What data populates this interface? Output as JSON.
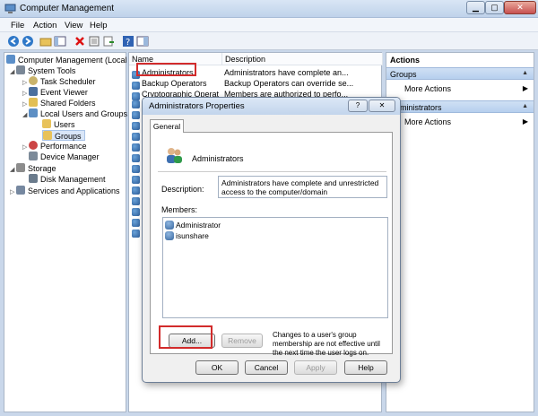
{
  "window": {
    "title": "Computer Management"
  },
  "menu": [
    "File",
    "Action",
    "View",
    "Help"
  ],
  "tree": [
    {
      "label": "Computer Management (Local",
      "indent": 0,
      "arrow": ""
    },
    {
      "label": "System Tools",
      "indent": 1,
      "arrow": "◢"
    },
    {
      "label": "Task Scheduler",
      "indent": 2,
      "arrow": "▷"
    },
    {
      "label": "Event Viewer",
      "indent": 2,
      "arrow": "▷"
    },
    {
      "label": "Shared Folders",
      "indent": 2,
      "arrow": "▷"
    },
    {
      "label": "Local Users and Groups",
      "indent": 2,
      "arrow": "◢"
    },
    {
      "label": "Users",
      "indent": 3,
      "arrow": ""
    },
    {
      "label": "Groups",
      "indent": 3,
      "arrow": ""
    },
    {
      "label": "Performance",
      "indent": 2,
      "arrow": "▷"
    },
    {
      "label": "Device Manager",
      "indent": 2,
      "arrow": ""
    },
    {
      "label": "Storage",
      "indent": 1,
      "arrow": "◢"
    },
    {
      "label": "Disk Management",
      "indent": 2,
      "arrow": ""
    },
    {
      "label": "Services and Applications",
      "indent": 1,
      "arrow": "▷"
    }
  ],
  "list": {
    "columns": [
      "Name",
      "Description"
    ],
    "rows": [
      {
        "name": "Administrators",
        "desc": "Administrators have complete an..."
      },
      {
        "name": "Backup Operators",
        "desc": "Backup Operators can override se..."
      },
      {
        "name": "Cryptographic Operat",
        "desc": "Members are authorized to perfo..."
      },
      {
        "name": "",
        "desc": ""
      },
      {
        "name": "",
        "desc": ""
      },
      {
        "name": "",
        "desc": ""
      },
      {
        "name": "",
        "desc": ""
      },
      {
        "name": "",
        "desc": ""
      },
      {
        "name": "",
        "desc": ""
      },
      {
        "name": "",
        "desc": ""
      },
      {
        "name": "",
        "desc": ""
      },
      {
        "name": "",
        "desc": ""
      },
      {
        "name": "",
        "desc": ""
      },
      {
        "name": "",
        "desc": ""
      },
      {
        "name": "",
        "desc": ""
      },
      {
        "name": "",
        "desc": ""
      }
    ]
  },
  "actions": {
    "header": "Actions",
    "groups": [
      {
        "title": "Groups",
        "item": "More Actions"
      },
      {
        "title": "Administrators",
        "item": "More Actions"
      }
    ]
  },
  "dialog": {
    "title": "Administrators Properties",
    "help_button": "?",
    "close_button": "✕",
    "tab": "General",
    "group_name": "Administrators",
    "description_label": "Description:",
    "description_value": "Administrators have complete and unrestricted access to the computer/domain",
    "members_label": "Members:",
    "members": [
      "Administrator",
      "isunshare"
    ],
    "add_button": "Add...",
    "remove_button": "Remove",
    "note": "Changes to a user's group membership are not effective until the next time the user logs on.",
    "ok_button": "OK",
    "cancel_button": "Cancel",
    "apply_button": "Apply",
    "dialog_help_button": "Help"
  }
}
